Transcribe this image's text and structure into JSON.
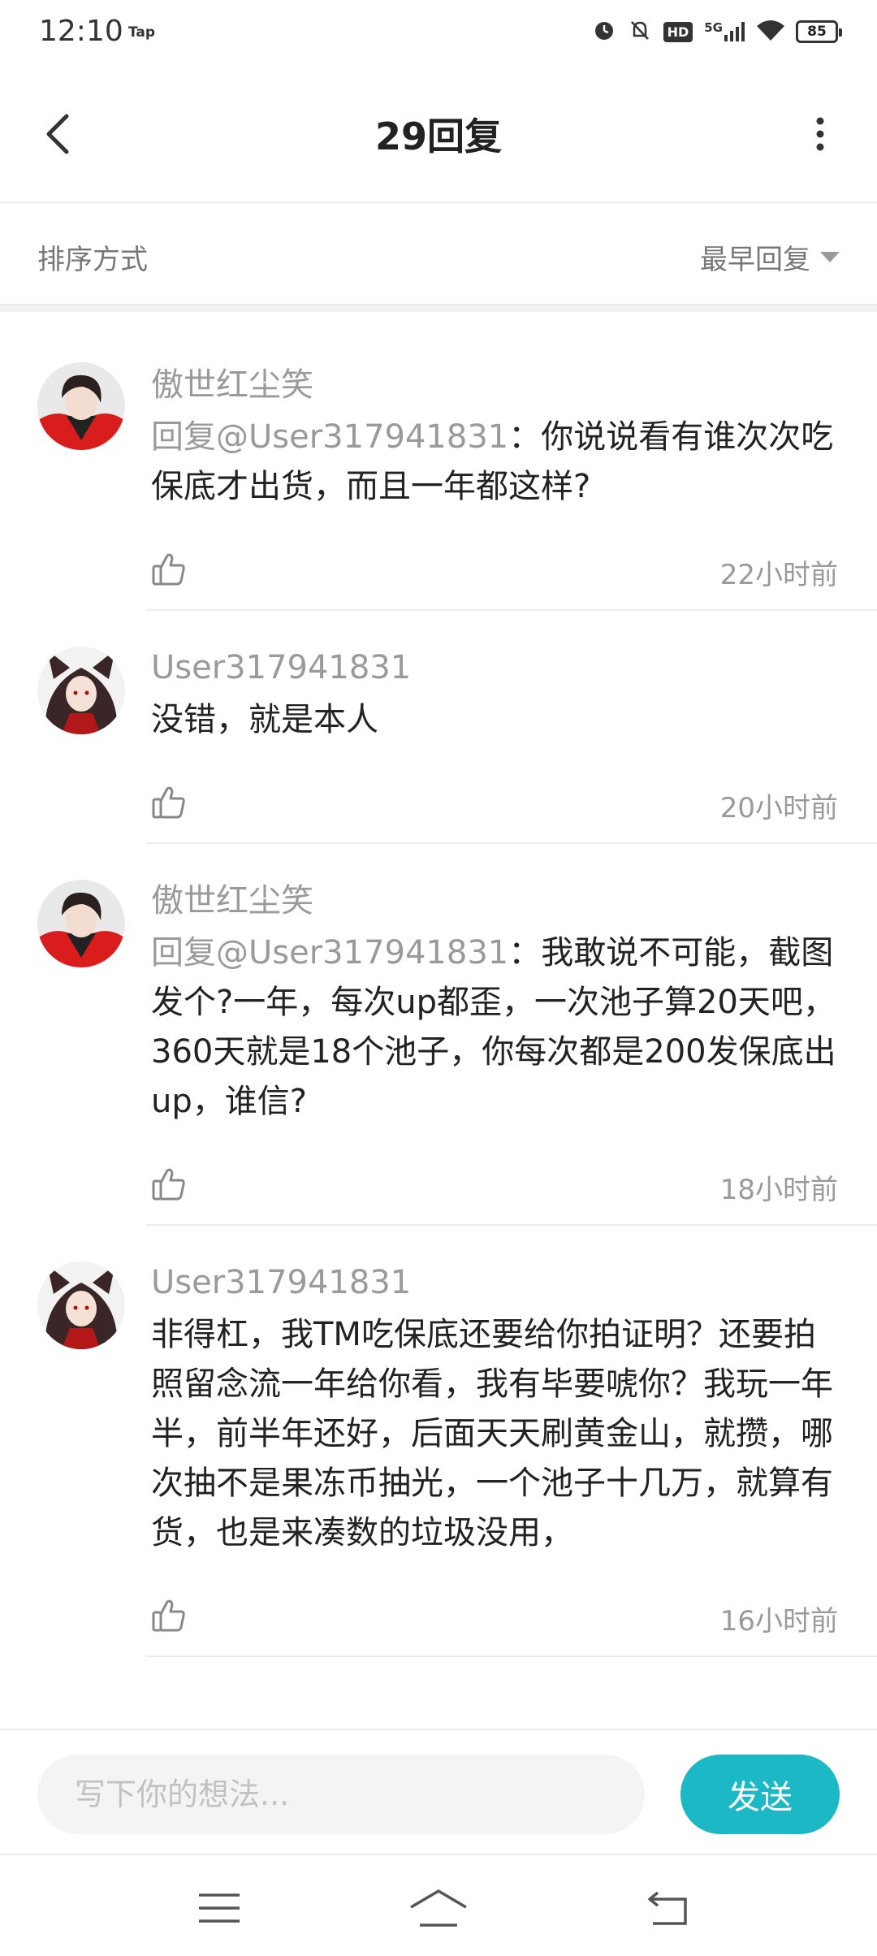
{
  "status_bar": {
    "time": "12:10",
    "tap_label": "Tap",
    "network": "5G",
    "hd": "HD",
    "battery": "85"
  },
  "header": {
    "title": "29回复"
  },
  "sort": {
    "label": "排序方式",
    "selected": "最早回复"
  },
  "comments": [
    {
      "username": "傲世红尘笑",
      "mention": "回复@User317941831",
      "text": "：你说说看有谁次次吃保底才出货，而且一年都这样?",
      "time": "22小时前"
    },
    {
      "username": "User317941831",
      "mention": "",
      "text": "没错，就是本人",
      "time": "20小时前"
    },
    {
      "username": "傲世红尘笑",
      "mention": "回复@User317941831",
      "text": "：我敢说不可能，截图发个?一年，每次up都歪，一次池子算20天吧，360天就是18个池子，你每次都是200发保底出up，谁信?",
      "time": "18小时前"
    },
    {
      "username": "User317941831",
      "mention": "",
      "text": "非得杠，我TM吃保底还要给你拍证明？还要拍照留念流一年给你看，我有毕要唬你？我玩一年半，前半年还好，后面天天刷黄金山，就攒，哪次抽不是果冻币抽光，一个池子十几万，就算有货，也是来凑数的垃圾没用，",
      "time": "16小时前"
    }
  ],
  "input": {
    "placeholder": "写下你的想法...",
    "send_label": "发送"
  },
  "colors": {
    "accent": "#1cb8c6",
    "muted_text": "#9a9a9a",
    "divider": "#ececec"
  },
  "icons": [
    "back-arrow-icon",
    "more-vertical-icon",
    "dropdown-triangle-icon",
    "thumbs-up-icon",
    "menu-icon",
    "home-icon",
    "return-icon",
    "alarm-icon",
    "mute-icon",
    "signal-icon",
    "wifi-icon",
    "battery-icon"
  ]
}
